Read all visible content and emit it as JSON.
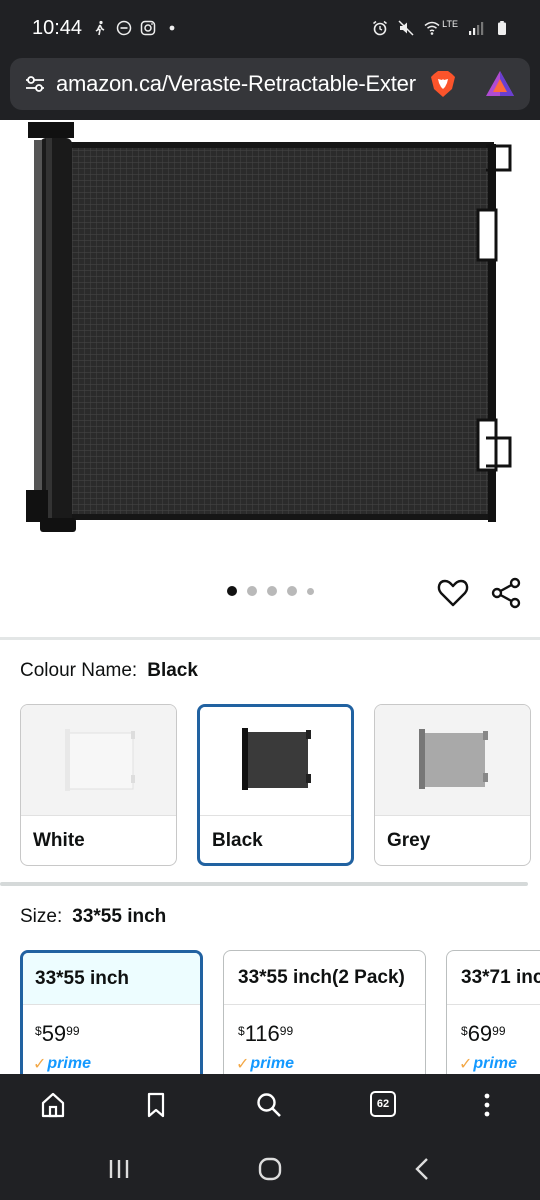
{
  "status_bar": {
    "time": "10:44",
    "lte_label": "LTE"
  },
  "url_bar": {
    "url": "amazon.ca/Veraste-Retractable-Exter"
  },
  "gallery": {
    "dot_count": 5,
    "active_index": 0
  },
  "colour": {
    "label": "Colour Name:",
    "selected_value": "Black",
    "options": [
      {
        "label": "White",
        "selected": false
      },
      {
        "label": "Black",
        "selected": true
      },
      {
        "label": "Grey",
        "selected": false
      }
    ]
  },
  "size": {
    "label": "Size:",
    "selected_value": "33*55 inch",
    "options": [
      {
        "label": "33*55 inch",
        "currency": "$",
        "price_whole": "59",
        "price_cents": "99",
        "prime": "prime",
        "selected": true
      },
      {
        "label": "33*55 inch(2 Pack)",
        "currency": "$",
        "price_whole": "116",
        "price_cents": "99",
        "prime": "prime",
        "selected": false
      },
      {
        "label": "33*71 inch",
        "currency": "$",
        "price_whole": "69",
        "price_cents": "99",
        "prime": "prime",
        "selected": false
      }
    ]
  },
  "browser_toolbar": {
    "tab_count": "62"
  },
  "colors": {
    "selected_border": "#2162a1",
    "prime_blue": "#1399ff",
    "prime_check": "#f3a847",
    "chrome_dark": "#202124"
  }
}
